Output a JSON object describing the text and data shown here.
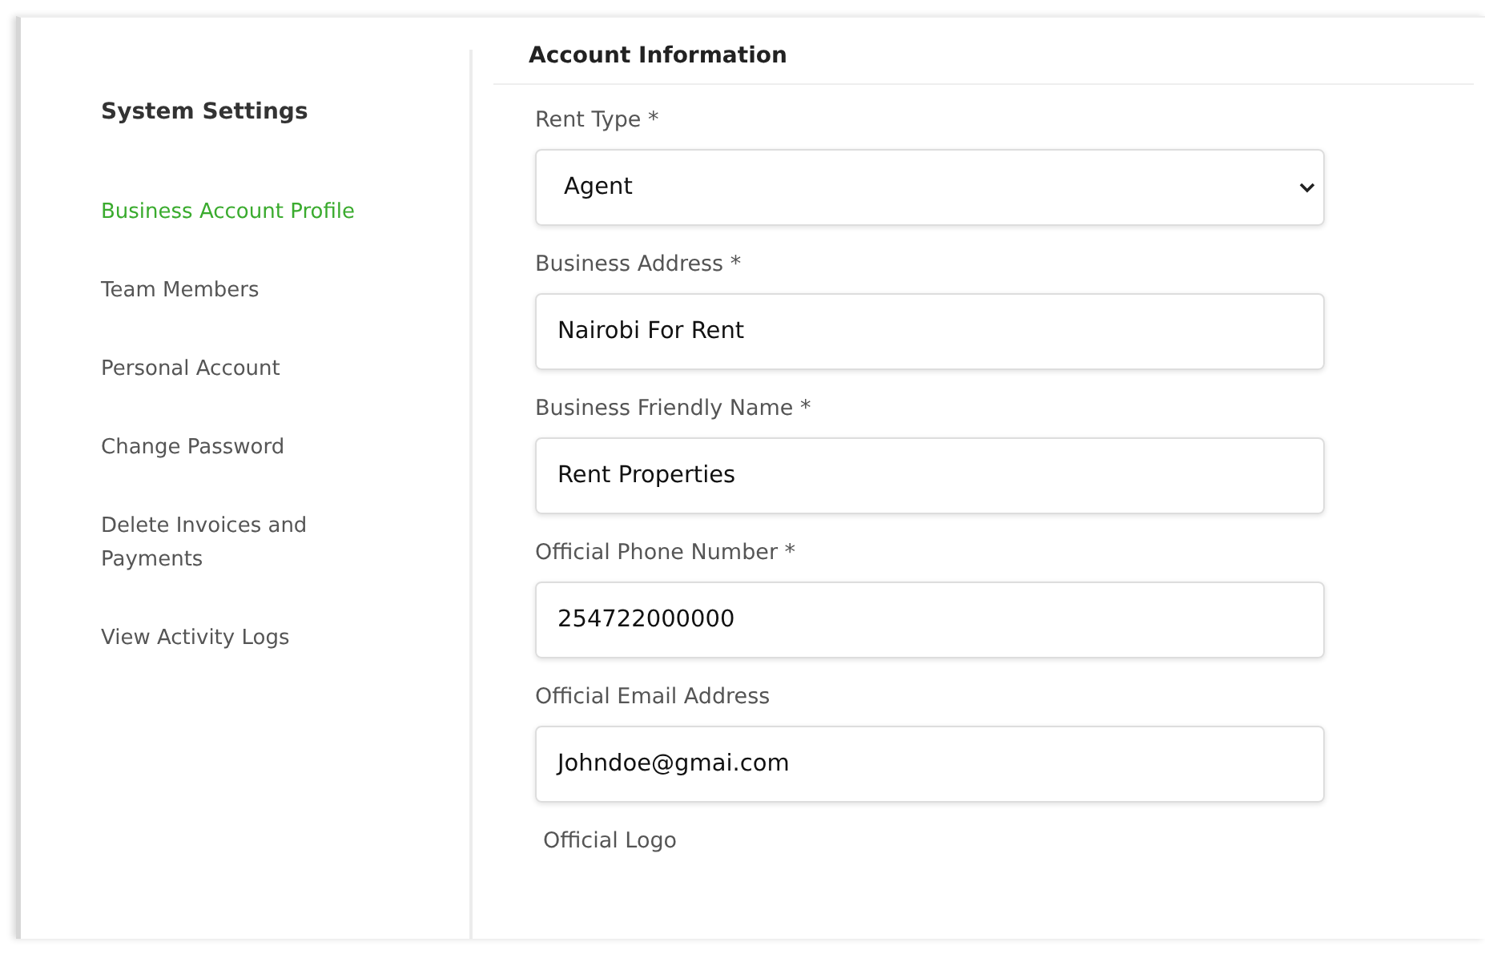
{
  "sidebar": {
    "title": "System Settings",
    "items": [
      {
        "label": "Business Account Profile",
        "selected": true
      },
      {
        "label": "Team Members",
        "selected": false
      },
      {
        "label": "Personal Account",
        "selected": false
      },
      {
        "label": "Change Password",
        "selected": false
      },
      {
        "label": "Delete Invoices and Payments",
        "selected": false
      },
      {
        "label": "View Activity Logs",
        "selected": false
      }
    ]
  },
  "section": {
    "title": "Account Information",
    "fields": [
      {
        "kind": "select",
        "label": "Rent Type *",
        "value": "Agent"
      },
      {
        "kind": "text",
        "label": "Business Address *",
        "value": "Nairobi For Rent"
      },
      {
        "kind": "text",
        "label": "Business Friendly Name *",
        "value": "Rent Properties"
      },
      {
        "kind": "text",
        "label": "Official Phone Number *",
        "value": "254722000000"
      },
      {
        "kind": "text",
        "label": "Official Email Address",
        "value": "Johndoe@gmai.com"
      },
      {
        "kind": "upload",
        "label": "Official Logo"
      }
    ]
  }
}
